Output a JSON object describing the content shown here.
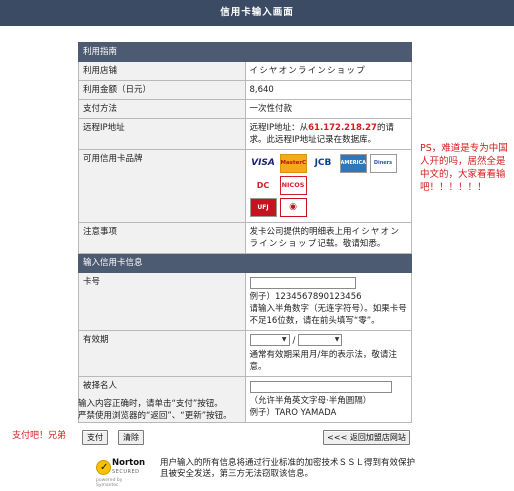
{
  "header": {
    "title": "信用卡输入画面"
  },
  "guide": {
    "section_title": "利用指南",
    "store_label": "利用店铺",
    "store_value": "イシヤオンラインショップ",
    "amount_label": "利用金额（日元）",
    "amount_value": "8,640",
    "payment_label": "支付方法",
    "payment_value": "一次性付款",
    "ip_label": "远程IP地址",
    "ip_prefix": "远程IP地址：从",
    "ip_value": "61.172.218.27",
    "ip_suffix": "的请求。此远程IP地址记录在数据库。",
    "brands_label": "可用信用卡品牌",
    "brands": [
      "VISA",
      "MasterCard",
      "JCB",
      "AMERICAN EXPRESS",
      "Diners Club",
      "DC",
      "NICOS",
      "UFJ",
      "SAISON"
    ],
    "notes_label": "注意事项",
    "notes_prefix": "发卡公司提供的明细表上用",
    "notes_store": "イシヤオンラインショップ",
    "notes_suffix": "记载。敬请知悉。"
  },
  "card_input": {
    "section_title": "输入信用卡信息",
    "number_label": "卡号",
    "number_value": "",
    "number_example": "例子）1234567890123456",
    "number_hint": "请输入半角数字（无连字符号）。如果卡号不足16位数，请在前头填写“零”。",
    "expiry_label": "有效期",
    "expiry_month": "",
    "expiry_year": "",
    "expiry_sep": "/",
    "expiry_hint": "通常有效期采用月/年的表示法，敬请注意。",
    "holder_label": "被择名人",
    "holder_value": "",
    "holder_hint": "（允许半角英文字母·半角圆隔）",
    "holder_example": "例子）TARO YAMADA"
  },
  "footer_notes": {
    "line1": "输入内容正确时，请单击“支付”按钮。",
    "line2": "严禁使用浏览器的“返回”、“更新”按钮。"
  },
  "buttons": {
    "pay": "支付",
    "clear": "清除",
    "back": "<<< 返回加盟店网站"
  },
  "annotations": {
    "left": "支付吧！兄弟",
    "right": "PS，难道是专为中国人开的吗，居然全是中文的，大家看看输吧！！！！！！"
  },
  "norton": {
    "brand": "Norton",
    "secured": "SECURED",
    "powered": "powered by Symantec"
  },
  "security_text": "用户输入的所有信息将通过行业标准的加密技术ＳＳＬ得到有效保护且被安全发送，第三方无法窃取该信息。",
  "colors": {
    "header_bg": "#3b4b63",
    "section_bg": "#4c5b71",
    "ip_color": "#d31c1c",
    "annotation_color": "#d41c1c"
  }
}
